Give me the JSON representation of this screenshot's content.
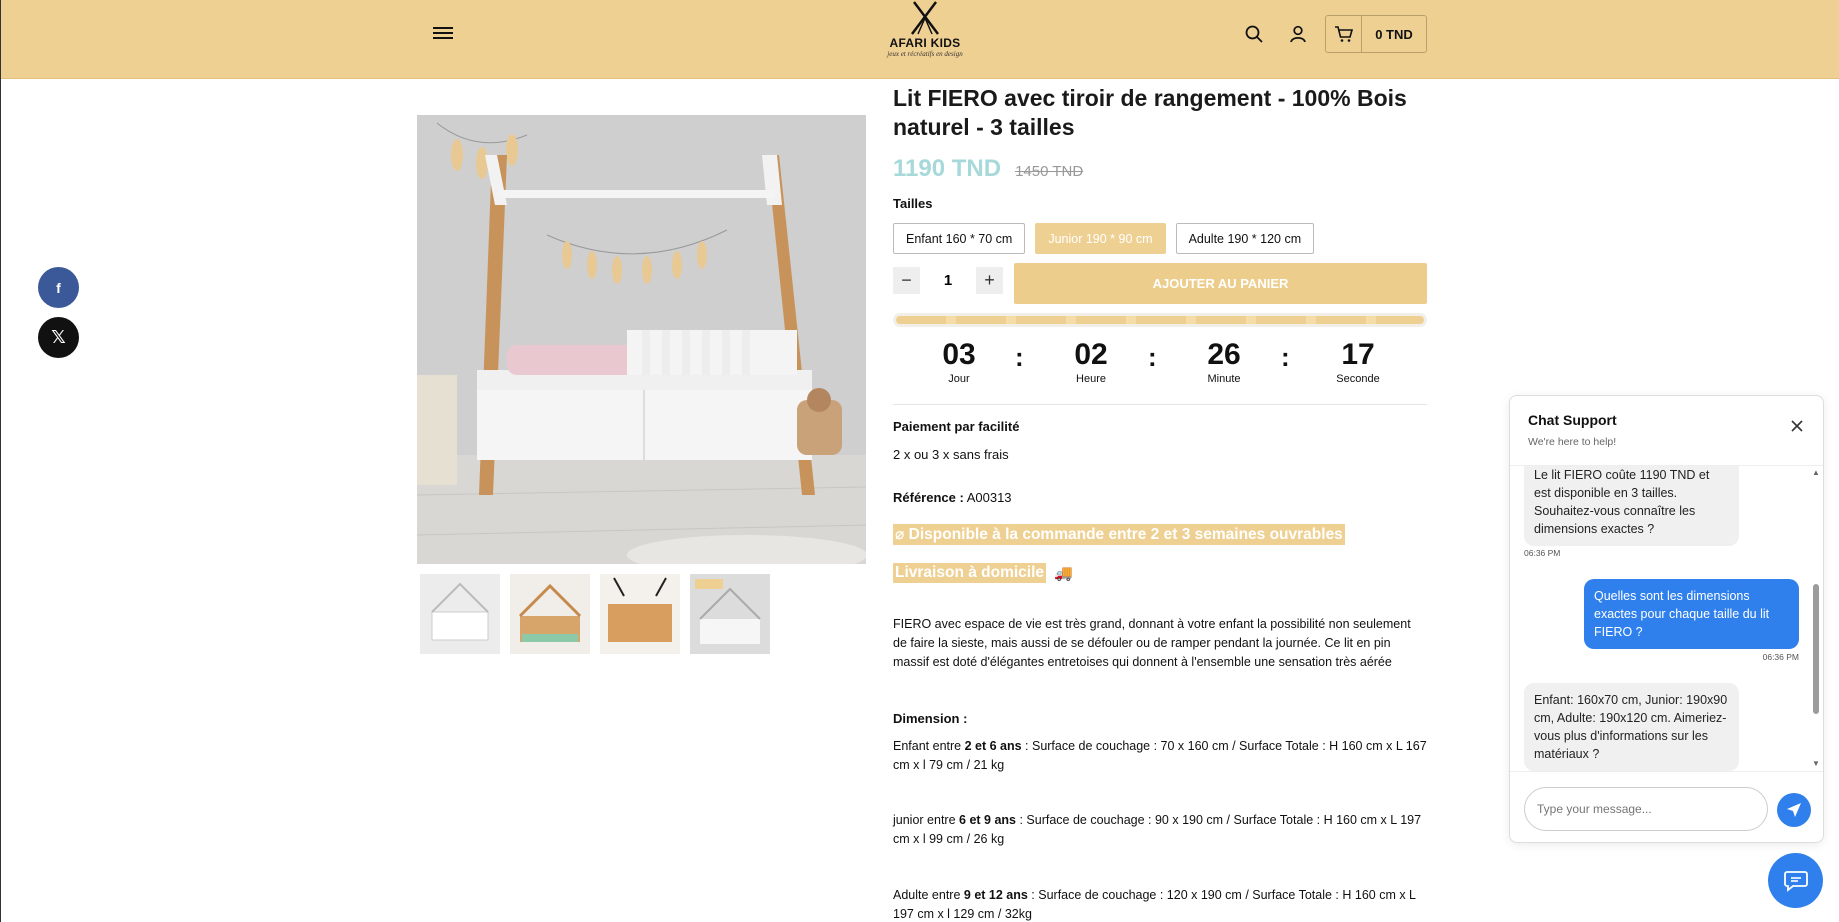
{
  "header": {
    "brand": "AFARI KIDS",
    "tagline": "jeux et récréatifs en design",
    "cart_total": "0 TND"
  },
  "product": {
    "title": "Lit FIERO avec tiroir de rangement - 100% Bois naturel - 3 tailles",
    "price": "1190 TND",
    "old_price": "1450 TND",
    "sizes_label": "Tailles",
    "sizes": [
      "Enfant 160 * 70 cm",
      "Junior 190 * 90 cm",
      "Adulte 190 * 120 cm"
    ],
    "selected_size": "Junior 190 * 90 cm",
    "quantity": "1",
    "add_to_cart": "AJOUTER AU PANIER",
    "countdown": [
      {
        "value": "03",
        "label": "Jour"
      },
      {
        "value": "02",
        "label": "Heure"
      },
      {
        "value": "26",
        "label": "Minute"
      },
      {
        "value": "17",
        "label": "Seconde"
      }
    ],
    "payment_title": "Paiement par facilité",
    "payment_text": "2 x ou 3 x sans frais",
    "reference_label": "Référence :",
    "reference_value": " A00313",
    "availability": "⌀ Disponible à la commande entre 2 et 3 semaines ouvrables",
    "delivery": "Livraison à domicile",
    "delivery_emoji": "🚚",
    "description": "FIERO avec espace de vie est très grand, donnant à votre enfant la possibilité non seulement de faire la sieste, mais aussi de se défouler ou de ramper pendant la journée. Ce lit en pin massif est doté d'élégantes entretoises qui donnent à l'ensemble une sensation très aérée",
    "dimension_title": "Dimension :",
    "dimensions": [
      {
        "prefix": "Enfant entre ",
        "ages": "2 et 6 ans",
        "rest": "  : Surface de couchage : 70 x 160 cm / Surface Totale : H 160 cm x L 167 cm x l 79 cm / 21 kg"
      },
      {
        "prefix": "junior entre ",
        "ages": "6 et 9 ans",
        "rest": "  : Surface de couchage :  90 x 190 cm / Surface Totale :  H 160 cm x L 197 cm x l 99 cm / 26 kg"
      },
      {
        "prefix": "Adulte entre ",
        "ages": "9 et 12 ans",
        "rest": "  : Surface de couchage :  120 x 190 cm / Surface Totale :  H 160 cm x L 197 cm x l 129 cm / 32kg"
      }
    ]
  },
  "chat": {
    "title": "Chat Support",
    "subtitle": "We're here to help!",
    "messages": [
      {
        "from": "bot",
        "text": "Le lit FIERO coûte 1190 TND et est disponible en 3 tailles. Souhaitez-vous connaître les dimensions exactes ?",
        "time": "06:36 PM"
      },
      {
        "from": "user",
        "text": "Quelles sont les dimensions exactes pour chaque taille du lit FIERO ?",
        "time": "06:36 PM"
      },
      {
        "from": "bot",
        "text": "Enfant: 160x70 cm, Junior: 190x90 cm, Adulte: 190x120 cm. Aimeriez-vous plus d'informations sur les matériaux ?",
        "time": ""
      }
    ],
    "input_placeholder": "Type your message..."
  },
  "colors": {
    "header_bg": "#efd093",
    "price": "#a7d9da",
    "accent": "#edcd8b",
    "chat_blue": "#2f80ed",
    "facebook": "#3b5998"
  },
  "icons": [
    "menu-icon",
    "search-icon",
    "user-icon",
    "cart-icon",
    "facebook-icon",
    "x-icon",
    "close-icon",
    "send-icon",
    "chat-icon"
  ]
}
